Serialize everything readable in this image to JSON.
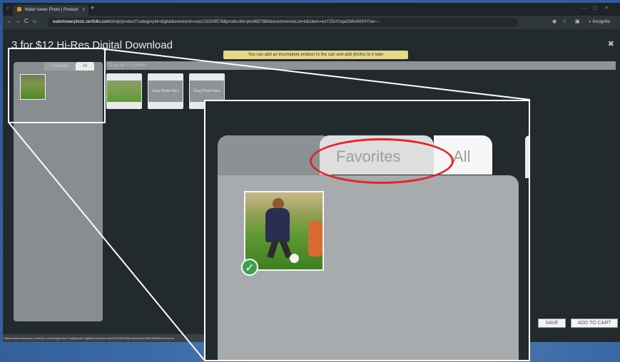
{
  "browser": {
    "tab_title": "Water tower Photo | Product",
    "tab_close": "×",
    "new_tab": "+",
    "url_host": "watertowerphoto.zenfolio.com",
    "url_path": "/shop/product?categoryId=digital&vendorId=user131509576&productId=prod637886&ecommerceList=k&token=ezYZfuYUqaGMx4XHVYzw~~",
    "incognito_label": "Incognito",
    "nav_back": "←",
    "nav_forward": "→",
    "nav_reload": "C",
    "nav_home": "⌂"
  },
  "dialog": {
    "title": "3 for $12 Hi-Res Digital Download",
    "close": "✖",
    "toast": "You can add an incomplete product to the cart and add photos to it later",
    "drag_bar": "Drag up to 3 photos",
    "tabs": {
      "favorites": "Favorites",
      "all": "All"
    },
    "slots": [
      "",
      "Drag Photo Here",
      "Drag Photo Here"
    ],
    "save": "SAVE",
    "add_to_cart": "ADD TO CART"
  },
  "status_bar": "https://watertowerphoto.zenfolio.com/shop/product?categoryId=digital&vendorId=user131509576&productId=prod637886&ecommerce",
  "zoom": {
    "favorites": "Favorites",
    "all": "All"
  },
  "colors": {
    "highlight_ring": "#e0262b",
    "toast_bg": "#e6d98a",
    "check_green": "#3aa14a",
    "favicon": "#f08a24"
  }
}
